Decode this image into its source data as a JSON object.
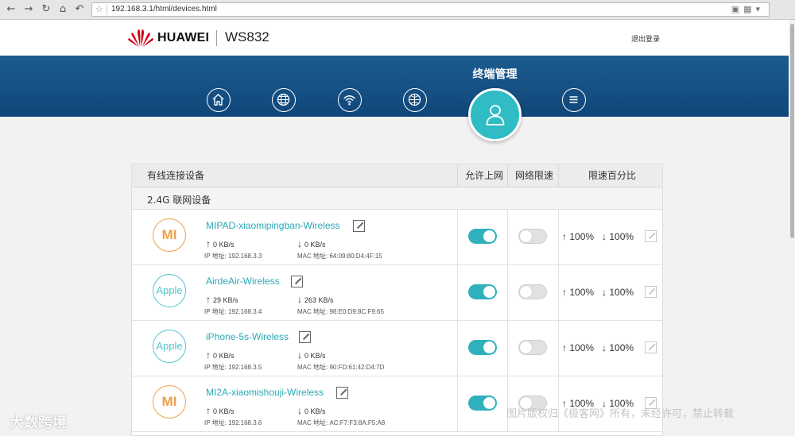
{
  "browser": {
    "url": "192.168.3.1/html/devices.html",
    "nav_icons": [
      "back-icon",
      "forward-icon",
      "reload-icon",
      "home-icon",
      "undo-icon"
    ]
  },
  "header": {
    "brand": "HUAWEI",
    "model": "WS832",
    "logout": "退出登录"
  },
  "nav": {
    "active_title": "终端管理",
    "items": [
      "home-icon",
      "globe-icon",
      "wifi-icon",
      "network-icon",
      "user-icon",
      "menu-icon"
    ],
    "accent": "#2fbcc4"
  },
  "table": {
    "headers": {
      "device": "有线连接设备",
      "allow": "允许上网",
      "limit": "网络限速",
      "percent": "限速百分比"
    },
    "group": "2.4G 联网设备",
    "rows": [
      {
        "icon": "MI",
        "icon_type": "mi",
        "name": "MIPAD-xiaomipingban-Wireless",
        "up": "0 KB/s",
        "down": "0 KB/s",
        "ip": "IP 地址: 192.168.3.3",
        "mac": "MAC 地址: 64:09:80:D4:4F:15",
        "allow": true,
        "limit": false,
        "up_pct": "100%",
        "down_pct": "100%"
      },
      {
        "icon": "Apple",
        "icon_type": "apple",
        "name": "AirdeAir-Wireless",
        "up": "29 KB/s",
        "down": "263 KB/s",
        "ip": "IP 地址: 192.168.3.4",
        "mac": "MAC 地址: 98:E0:D9:8C:F9:65",
        "allow": true,
        "limit": false,
        "up_pct": "100%",
        "down_pct": "100%"
      },
      {
        "icon": "Apple",
        "icon_type": "apple",
        "name": "iPhone-5s-Wireless",
        "up": "0 KB/s",
        "down": "0 KB/s",
        "ip": "IP 地址: 192.168.3.5",
        "mac": "MAC 地址: 90:FD:61:42:D4:7D",
        "allow": true,
        "limit": false,
        "up_pct": "100%",
        "down_pct": "100%"
      },
      {
        "icon": "MI",
        "icon_type": "mi",
        "name": "MI2A-xiaomishouji-Wireless",
        "up": "0 KB/s",
        "down": "0 KB/s",
        "ip": "IP 地址: 192.168.3.6",
        "mac": "MAC 地址: AC:F7:F3:8A:F5:A8",
        "allow": true,
        "limit": false,
        "up_pct": "100%",
        "down_pct": "100%"
      }
    ]
  },
  "watermark": {
    "left": "大数跨境",
    "right": "图片版权归《极客网》所有，未经许可，禁止转载"
  }
}
